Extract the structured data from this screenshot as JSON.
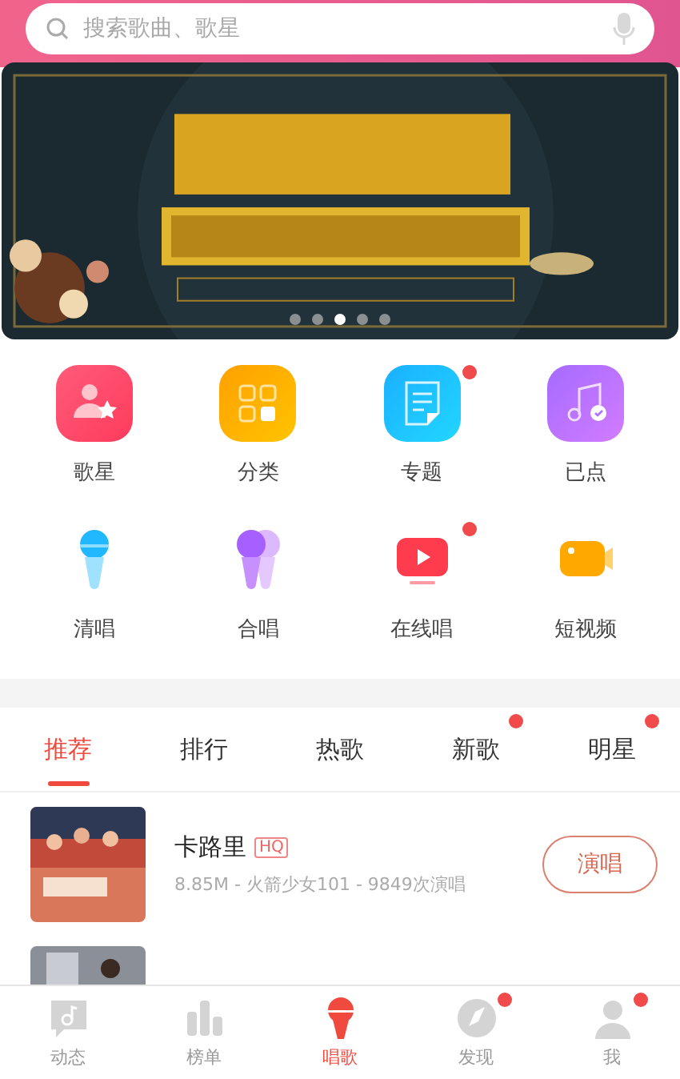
{
  "search": {
    "placeholder": "搜索歌曲、歌星"
  },
  "banner": {
    "kind": "picture",
    "dots": [
      {
        "selected": false
      },
      {
        "selected": false
      },
      {
        "selected": true
      },
      {
        "selected": false
      },
      {
        "selected": false
      }
    ]
  },
  "shortcuts": [
    {
      "kind": "singer",
      "label": "歌星",
      "badge": false
    },
    {
      "kind": "category",
      "label": "分类",
      "badge": false
    },
    {
      "kind": "topic",
      "label": "专题",
      "badge": true
    },
    {
      "kind": "ordered",
      "label": "已点",
      "badge": false
    },
    {
      "kind": "solo",
      "label": "清唱",
      "badge": false
    },
    {
      "kind": "duet",
      "label": "合唱",
      "badge": false
    },
    {
      "kind": "live",
      "label": "在线唱",
      "badge": true
    },
    {
      "kind": "video",
      "label": "短视频",
      "badge": false
    }
  ],
  "tabs": [
    {
      "label": "推荐",
      "selected": true,
      "badge": false
    },
    {
      "label": "排行",
      "selected": false,
      "badge": false
    },
    {
      "label": "热歌",
      "selected": false,
      "badge": false
    },
    {
      "label": "新歌",
      "selected": false,
      "badge": true
    },
    {
      "label": "明星",
      "selected": false,
      "badge": true
    }
  ],
  "songs": [
    {
      "title": "卡路里",
      "tag": "HQ",
      "meta": "8.85M - 火箭少女101 - 9849次演唱",
      "action": "演唱"
    }
  ],
  "bottom_nav": [
    {
      "kind": "feed",
      "label": "动态",
      "selected": false,
      "badge": false
    },
    {
      "kind": "charts",
      "label": "榜单",
      "selected": false,
      "badge": false
    },
    {
      "kind": "sing",
      "label": "唱歌",
      "selected": true,
      "badge": false
    },
    {
      "kind": "discover",
      "label": "发现",
      "selected": false,
      "badge": true
    },
    {
      "kind": "me",
      "label": "我",
      "selected": false,
      "badge": true
    }
  ]
}
